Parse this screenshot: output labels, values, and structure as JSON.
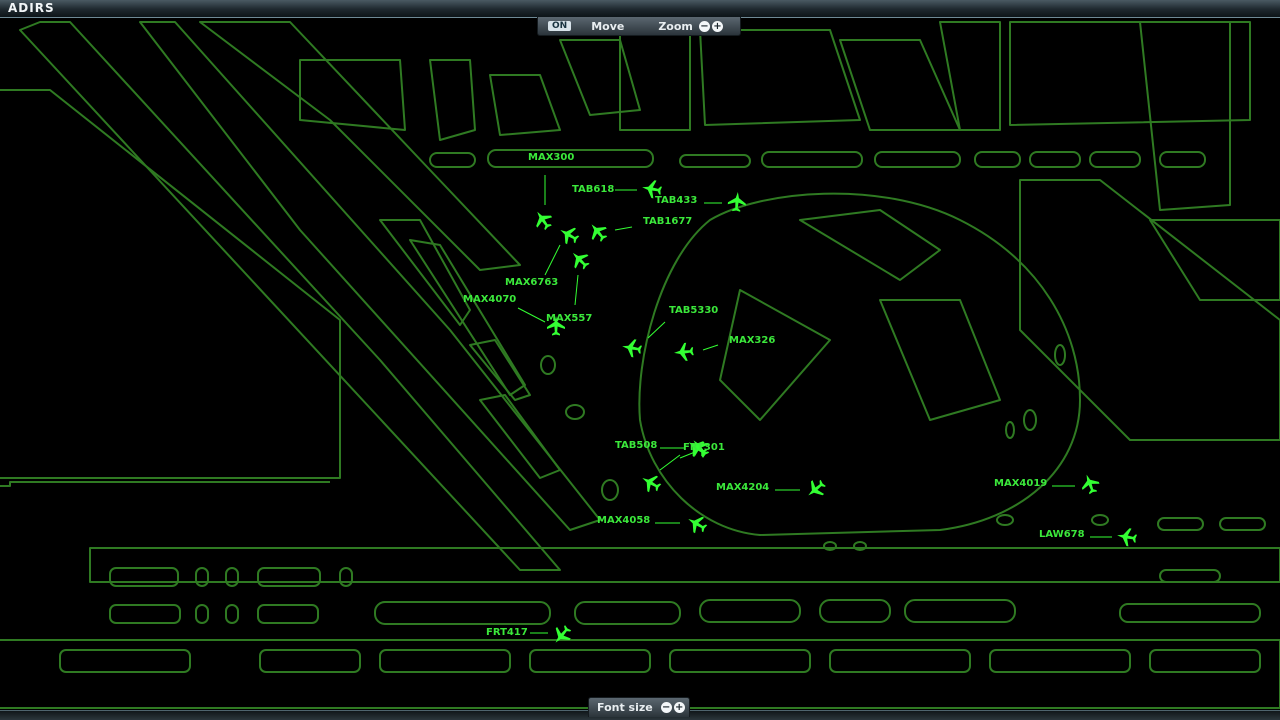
{
  "app": {
    "title": "ADIRS"
  },
  "map_controls": {
    "status_badge": "ON",
    "move_label": "Move",
    "zoom_label": "Zoom",
    "zoom_out": "−",
    "zoom_in": "+"
  },
  "font_controls": {
    "label": "Font size",
    "decrease": "−",
    "increase": "+"
  },
  "colors": {
    "map_outline": "#2f7a22",
    "aircraft": "#33ff33",
    "background": "#000000"
  },
  "aircraft": [
    {
      "callsign": "MAX300"
    },
    {
      "callsign": "TAB618"
    },
    {
      "callsign": "TAB433"
    },
    {
      "callsign": "TAB1677"
    },
    {
      "callsign": "MAX6763"
    },
    {
      "callsign": "MAX4070"
    },
    {
      "callsign": "MAX557"
    },
    {
      "callsign": "TAB5330"
    },
    {
      "callsign": "MAX326"
    },
    {
      "callsign": "TAB508"
    },
    {
      "callsign": "FRT301"
    },
    {
      "callsign": "MAX4204"
    },
    {
      "callsign": "MAX4019"
    },
    {
      "callsign": "MAX4058"
    },
    {
      "callsign": "LAW678"
    },
    {
      "callsign": "FRT417"
    }
  ]
}
